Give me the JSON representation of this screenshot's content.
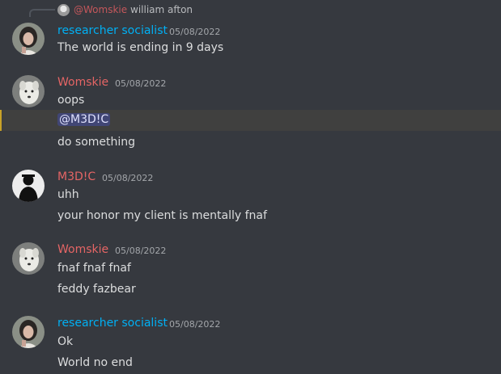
{
  "colors": {
    "background": "#36393f",
    "name_teal": "#00b0f4",
    "name_red": "#e56565",
    "mention_bg": "#414675",
    "mention_fg": "#dee0fc",
    "highlight_bar": "#c9a227"
  },
  "reply": {
    "author": "@Womskie",
    "text": "william afton"
  },
  "messages": [
    {
      "author": "researcher socialist",
      "timestamp": "05/08/2022",
      "avatar": "girl-photo-avatar",
      "lines": [
        "The world is ending in 9 days"
      ]
    },
    {
      "author": "Womskie",
      "timestamp": "05/08/2022",
      "avatar": "white-dog-avatar",
      "lines": [
        "oops",
        "@M3D!C",
        "do something"
      ]
    },
    {
      "author": "M3D!C",
      "timestamp": "05/08/2022",
      "avatar": "silhouette-avatar",
      "lines": [
        "uhh",
        "your honor my client is mentally fnaf"
      ]
    },
    {
      "author": "Womskie",
      "timestamp": "05/08/2022",
      "avatar": "white-dog-avatar",
      "lines": [
        "fnaf fnaf fnaf",
        "feddy fazbear"
      ]
    },
    {
      "author": "researcher socialist",
      "timestamp": "05/08/2022",
      "avatar": "girl-photo-avatar",
      "lines": [
        "Ok",
        "World no end"
      ]
    }
  ]
}
